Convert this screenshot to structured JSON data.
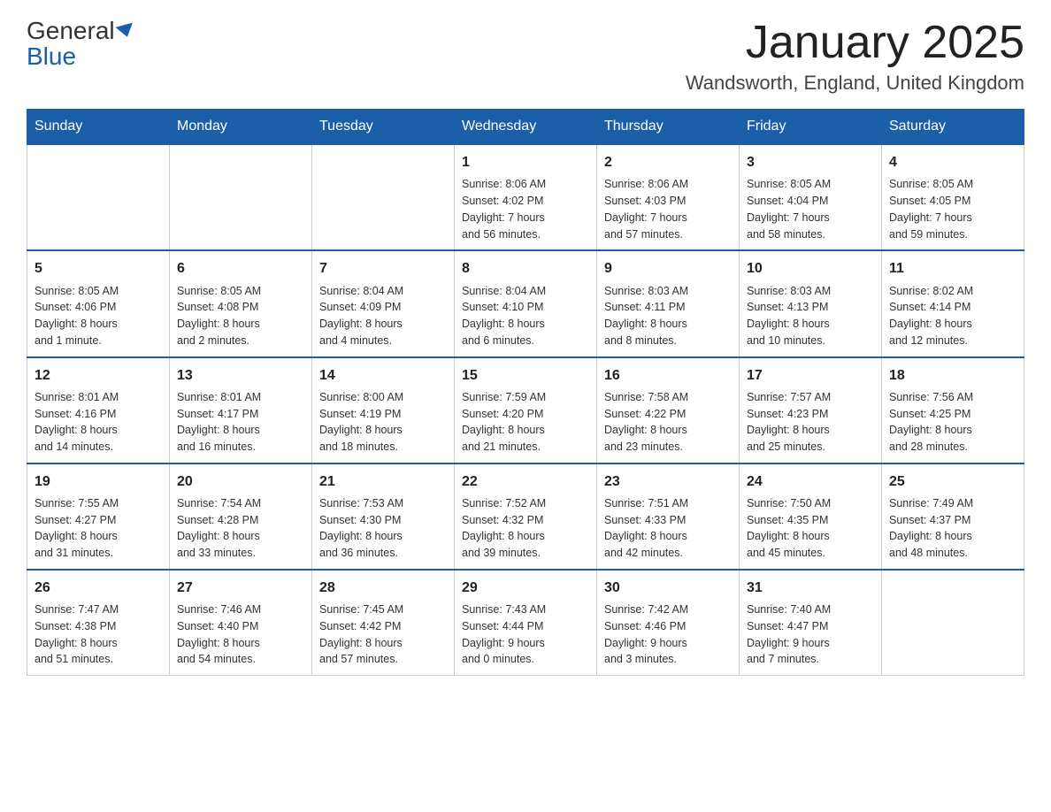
{
  "logo": {
    "text_general": "General",
    "text_blue": "Blue"
  },
  "title": "January 2025",
  "location": "Wandsworth, England, United Kingdom",
  "days_of_week": [
    "Sunday",
    "Monday",
    "Tuesday",
    "Wednesday",
    "Thursday",
    "Friday",
    "Saturday"
  ],
  "weeks": [
    [
      {
        "day": "",
        "info": ""
      },
      {
        "day": "",
        "info": ""
      },
      {
        "day": "",
        "info": ""
      },
      {
        "day": "1",
        "info": "Sunrise: 8:06 AM\nSunset: 4:02 PM\nDaylight: 7 hours\nand 56 minutes."
      },
      {
        "day": "2",
        "info": "Sunrise: 8:06 AM\nSunset: 4:03 PM\nDaylight: 7 hours\nand 57 minutes."
      },
      {
        "day": "3",
        "info": "Sunrise: 8:05 AM\nSunset: 4:04 PM\nDaylight: 7 hours\nand 58 minutes."
      },
      {
        "day": "4",
        "info": "Sunrise: 8:05 AM\nSunset: 4:05 PM\nDaylight: 7 hours\nand 59 minutes."
      }
    ],
    [
      {
        "day": "5",
        "info": "Sunrise: 8:05 AM\nSunset: 4:06 PM\nDaylight: 8 hours\nand 1 minute."
      },
      {
        "day": "6",
        "info": "Sunrise: 8:05 AM\nSunset: 4:08 PM\nDaylight: 8 hours\nand 2 minutes."
      },
      {
        "day": "7",
        "info": "Sunrise: 8:04 AM\nSunset: 4:09 PM\nDaylight: 8 hours\nand 4 minutes."
      },
      {
        "day": "8",
        "info": "Sunrise: 8:04 AM\nSunset: 4:10 PM\nDaylight: 8 hours\nand 6 minutes."
      },
      {
        "day": "9",
        "info": "Sunrise: 8:03 AM\nSunset: 4:11 PM\nDaylight: 8 hours\nand 8 minutes."
      },
      {
        "day": "10",
        "info": "Sunrise: 8:03 AM\nSunset: 4:13 PM\nDaylight: 8 hours\nand 10 minutes."
      },
      {
        "day": "11",
        "info": "Sunrise: 8:02 AM\nSunset: 4:14 PM\nDaylight: 8 hours\nand 12 minutes."
      }
    ],
    [
      {
        "day": "12",
        "info": "Sunrise: 8:01 AM\nSunset: 4:16 PM\nDaylight: 8 hours\nand 14 minutes."
      },
      {
        "day": "13",
        "info": "Sunrise: 8:01 AM\nSunset: 4:17 PM\nDaylight: 8 hours\nand 16 minutes."
      },
      {
        "day": "14",
        "info": "Sunrise: 8:00 AM\nSunset: 4:19 PM\nDaylight: 8 hours\nand 18 minutes."
      },
      {
        "day": "15",
        "info": "Sunrise: 7:59 AM\nSunset: 4:20 PM\nDaylight: 8 hours\nand 21 minutes."
      },
      {
        "day": "16",
        "info": "Sunrise: 7:58 AM\nSunset: 4:22 PM\nDaylight: 8 hours\nand 23 minutes."
      },
      {
        "day": "17",
        "info": "Sunrise: 7:57 AM\nSunset: 4:23 PM\nDaylight: 8 hours\nand 25 minutes."
      },
      {
        "day": "18",
        "info": "Sunrise: 7:56 AM\nSunset: 4:25 PM\nDaylight: 8 hours\nand 28 minutes."
      }
    ],
    [
      {
        "day": "19",
        "info": "Sunrise: 7:55 AM\nSunset: 4:27 PM\nDaylight: 8 hours\nand 31 minutes."
      },
      {
        "day": "20",
        "info": "Sunrise: 7:54 AM\nSunset: 4:28 PM\nDaylight: 8 hours\nand 33 minutes."
      },
      {
        "day": "21",
        "info": "Sunrise: 7:53 AM\nSunset: 4:30 PM\nDaylight: 8 hours\nand 36 minutes."
      },
      {
        "day": "22",
        "info": "Sunrise: 7:52 AM\nSunset: 4:32 PM\nDaylight: 8 hours\nand 39 minutes."
      },
      {
        "day": "23",
        "info": "Sunrise: 7:51 AM\nSunset: 4:33 PM\nDaylight: 8 hours\nand 42 minutes."
      },
      {
        "day": "24",
        "info": "Sunrise: 7:50 AM\nSunset: 4:35 PM\nDaylight: 8 hours\nand 45 minutes."
      },
      {
        "day": "25",
        "info": "Sunrise: 7:49 AM\nSunset: 4:37 PM\nDaylight: 8 hours\nand 48 minutes."
      }
    ],
    [
      {
        "day": "26",
        "info": "Sunrise: 7:47 AM\nSunset: 4:38 PM\nDaylight: 8 hours\nand 51 minutes."
      },
      {
        "day": "27",
        "info": "Sunrise: 7:46 AM\nSunset: 4:40 PM\nDaylight: 8 hours\nand 54 minutes."
      },
      {
        "day": "28",
        "info": "Sunrise: 7:45 AM\nSunset: 4:42 PM\nDaylight: 8 hours\nand 57 minutes."
      },
      {
        "day": "29",
        "info": "Sunrise: 7:43 AM\nSunset: 4:44 PM\nDaylight: 9 hours\nand 0 minutes."
      },
      {
        "day": "30",
        "info": "Sunrise: 7:42 AM\nSunset: 4:46 PM\nDaylight: 9 hours\nand 3 minutes."
      },
      {
        "day": "31",
        "info": "Sunrise: 7:40 AM\nSunset: 4:47 PM\nDaylight: 9 hours\nand 7 minutes."
      },
      {
        "day": "",
        "info": ""
      }
    ]
  ]
}
